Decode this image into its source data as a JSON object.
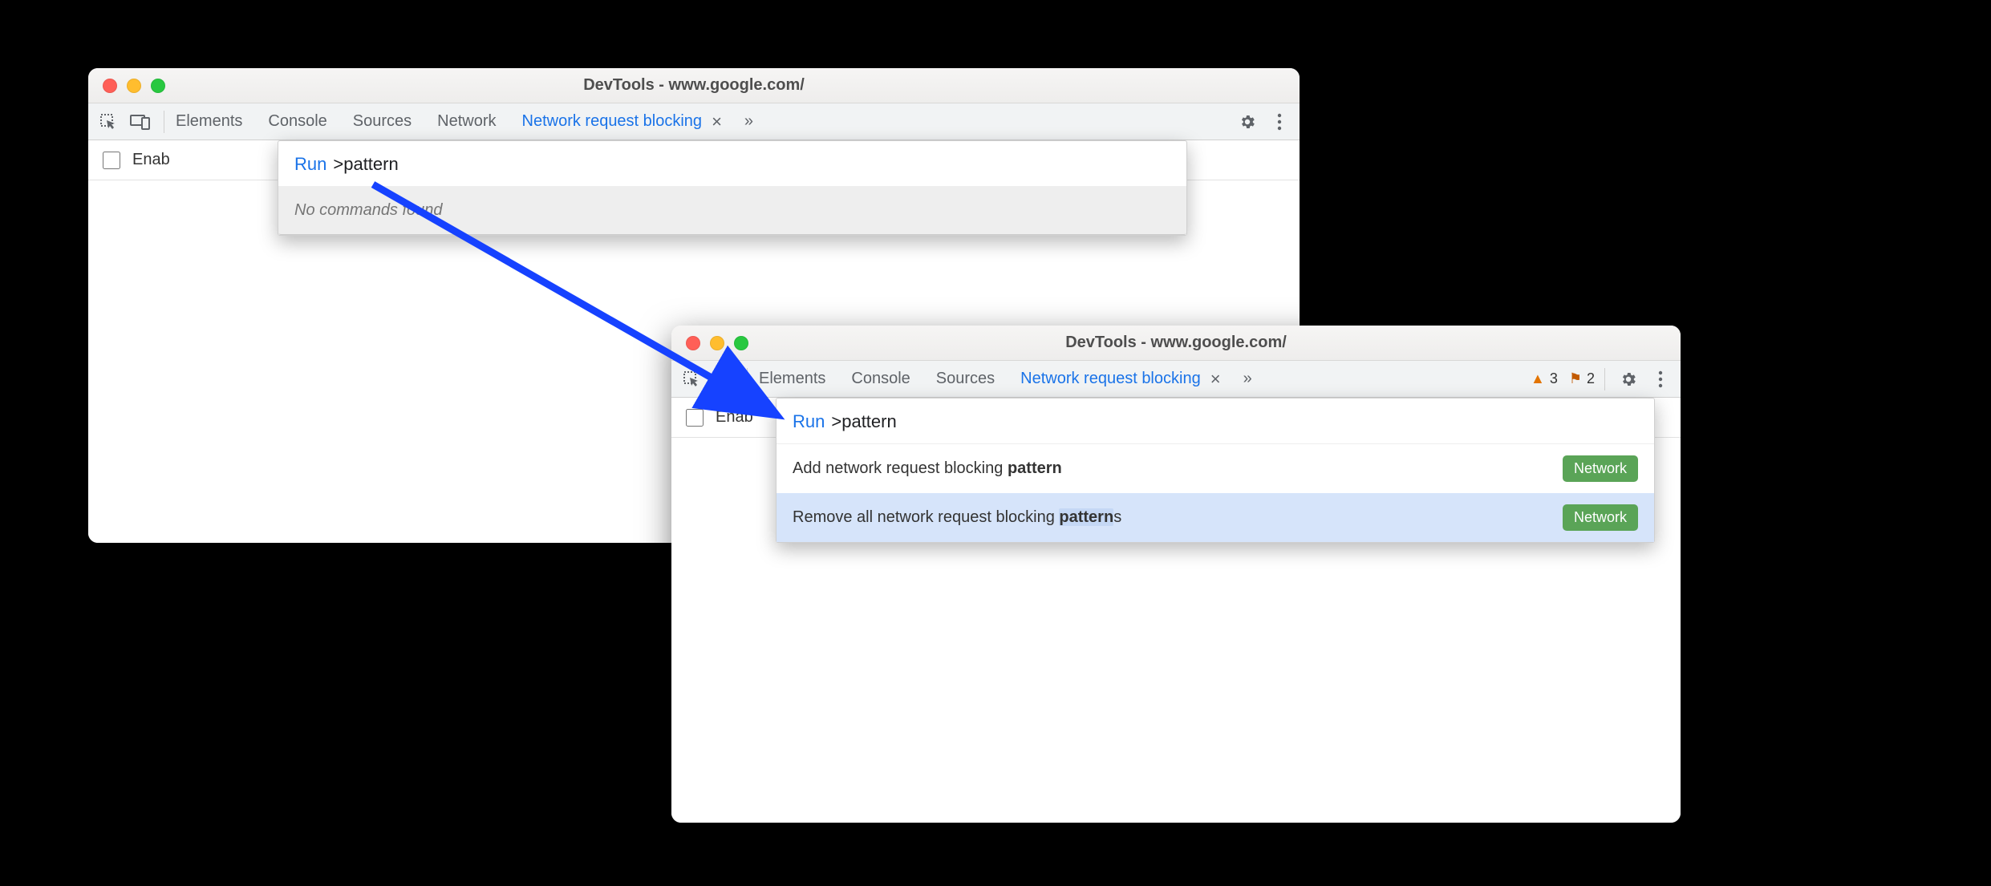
{
  "window_left": {
    "title": "DevTools - www.google.com/",
    "tabs": [
      "Elements",
      "Console",
      "Sources",
      "Network",
      "Network request blocking"
    ],
    "active_tab_index": 4,
    "enable_checkbox_label": "Enab",
    "command_menu": {
      "run_label": "Run",
      "query_prefix": ">",
      "query": "pattern",
      "no_results": "No commands found"
    }
  },
  "window_right": {
    "title": "DevTools - www.google.com/",
    "tabs": [
      "Elements",
      "Console",
      "Sources",
      "Network request blocking"
    ],
    "active_tab_index": 3,
    "warnings_count": "3",
    "issues_count": "2",
    "enable_checkbox_label": "Enab",
    "command_menu": {
      "run_label": "Run",
      "query_prefix": ">",
      "query": "pattern",
      "results": [
        {
          "before": "Add network request blocking ",
          "match": "pattern",
          "after": "",
          "badge": "Network"
        },
        {
          "before": "Remove all network request blocking ",
          "match": "pattern",
          "after": "s",
          "badge": "Network"
        }
      ],
      "selected_index": 1
    }
  }
}
